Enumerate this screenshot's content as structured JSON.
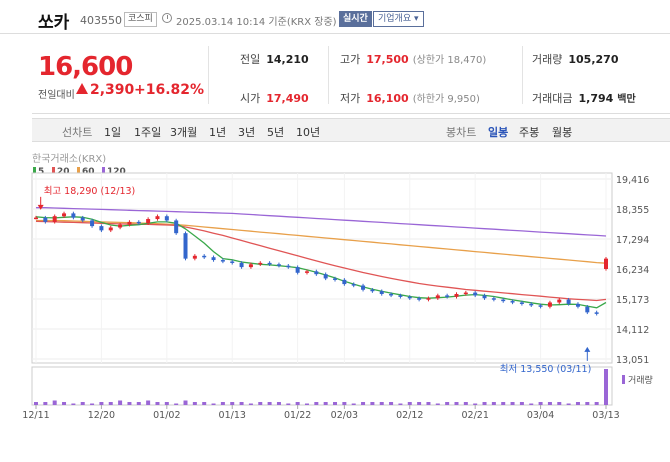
{
  "header": {
    "name": "쏘카",
    "code": "403550",
    "market": "코스피",
    "asof": "2025.03.14 10:14 기준(KRX 장중)",
    "realtime": "실시간",
    "company": "기업개요 ▾"
  },
  "quote": {
    "price": "16,600",
    "prev_label": "전일대비",
    "change": "2,390",
    "change_pct": "+16.82%",
    "prev_close": {
      "label": "전일",
      "value": "14,210"
    },
    "open": {
      "label": "시가",
      "value": "17,490"
    },
    "high": {
      "label": "고가",
      "value": "17,500",
      "sub": "(상한가 18,470)"
    },
    "low": {
      "label": "저가",
      "value": "16,100",
      "sub": "(하한가 9,950)"
    },
    "volume": {
      "label": "거래량",
      "value": "105,270"
    },
    "amount": {
      "label": "거래대금",
      "value": "1,794",
      "unit": "백만"
    }
  },
  "period": {
    "label": "선차트",
    "items": [
      "1일",
      "1주일",
      "3개월",
      "1년",
      "3년",
      "5년",
      "10년"
    ]
  },
  "candle_tabs": {
    "label": "봉차트",
    "items": [
      "일봉",
      "주봉",
      "월봉"
    ],
    "selected": 0
  },
  "chart_data": {
    "type": "line",
    "source_label": "한국거래소(KRX)",
    "ma_legend": [
      {
        "name": "5",
        "color": "#3aa84a"
      },
      {
        "name": "20",
        "color": "#e05555"
      },
      {
        "name": "60",
        "color": "#e8a04a"
      },
      {
        "name": "120",
        "color": "#9a66d6"
      }
    ],
    "y_ticks": [
      19416,
      18355,
      17294,
      16234,
      15173,
      14112,
      13051
    ],
    "y_tick_labels": [
      "19,416",
      "18,355",
      "17,294",
      "16,234",
      "15,173",
      "14,112",
      "13,051"
    ],
    "ylim": [
      13051,
      19416
    ],
    "x_ticks": [
      "12/11",
      "12/20",
      "01/02",
      "01/13",
      "01/22",
      "02/03",
      "02/12",
      "02/21",
      "03/04",
      "03/13"
    ],
    "x_tick_index": [
      0,
      7,
      14,
      21,
      28,
      33,
      40,
      47,
      54,
      61
    ],
    "n_days": 62,
    "close": [
      18050,
      17900,
      18100,
      18200,
      18050,
      17950,
      17750,
      17600,
      17700,
      17800,
      17900,
      17850,
      18000,
      18100,
      17950,
      17500,
      16600,
      16700,
      16650,
      16550,
      16500,
      16450,
      16300,
      16400,
      16450,
      16400,
      16350,
      16300,
      16100,
      16150,
      16050,
      15900,
      15850,
      15700,
      15650,
      15500,
      15450,
      15350,
      15300,
      15250,
      15200,
      15150,
      15200,
      15300,
      15250,
      15350,
      15400,
      15300,
      15200,
      15150,
      15100,
      15050,
      15000,
      14950,
      14900,
      15050,
      15150,
      15000,
      14900,
      14700,
      14650,
      16600
    ],
    "ma5": [
      18080,
      18050,
      18040,
      18060,
      18080,
      18060,
      17990,
      17880,
      17790,
      17750,
      17780,
      17800,
      17850,
      17900,
      17900,
      17850,
      17650,
      17400,
      17150,
      16850,
      16600,
      16560,
      16480,
      16440,
      16400,
      16380,
      16350,
      16320,
      16280,
      16200,
      16120,
      16020,
      15920,
      15800,
      15700,
      15600,
      15520,
      15450,
      15380,
      15320,
      15260,
      15220,
      15200,
      15220,
      15240,
      15270,
      15310,
      15330,
      15300,
      15260,
      15200,
      15140,
      15090,
      15040,
      14990,
      14960,
      14970,
      14990,
      14980,
      14920,
      14860,
      15050
    ],
    "ma20": [
      17920,
      17910,
      17900,
      17890,
      17880,
      17870,
      17860,
      17850,
      17840,
      17830,
      17820,
      17810,
      17810,
      17800,
      17790,
      17780,
      17720,
      17650,
      17580,
      17500,
      17420,
      17330,
      17240,
      17150,
      17060,
      16970,
      16880,
      16790,
      16700,
      16610,
      16520,
      16430,
      16350,
      16270,
      16190,
      16110,
      16040,
      15970,
      15900,
      15840,
      15780,
      15720,
      15670,
      15630,
      15590,
      15550,
      15510,
      15480,
      15450,
      15420,
      15390,
      15360,
      15330,
      15300,
      15270,
      15240,
      15210,
      15180,
      15160,
      15140,
      15120,
      15160
    ],
    "ma60": [
      17950,
      17950,
      17950,
      17940,
      17930,
      17920,
      17910,
      17900,
      17890,
      17880,
      17870,
      17860,
      17850,
      17840,
      17820,
      17800,
      17780,
      17750,
      17720,
      17690,
      17660,
      17630,
      17600,
      17570,
      17540,
      17510,
      17480,
      17450,
      17420,
      17390,
      17360,
      17330,
      17300,
      17270,
      17240,
      17210,
      17180,
      17150,
      17120,
      17090,
      17060,
      17030,
      17000,
      16970,
      16940,
      16910,
      16880,
      16850,
      16820,
      16790,
      16760,
      16730,
      16700,
      16670,
      16640,
      16610,
      16580,
      16550,
      16520,
      16490,
      16460,
      16440
    ],
    "ma120": [
      18400,
      18400,
      18390,
      18380,
      18370,
      18360,
      18350,
      18340,
      18330,
      18320,
      18310,
      18300,
      18290,
      18280,
      18270,
      18260,
      18250,
      18240,
      18230,
      18220,
      18210,
      18200,
      18180,
      18160,
      18140,
      18120,
      18100,
      18080,
      18060,
      18040,
      18020,
      18000,
      17980,
      17960,
      17940,
      17920,
      17900,
      17880,
      17860,
      17840,
      17820,
      17800,
      17780,
      17760,
      17740,
      17720,
      17700,
      17680,
      17660,
      17640,
      17620,
      17600,
      17580,
      17560,
      17540,
      17520,
      17500,
      17480,
      17460,
      17440,
      17420,
      17400
    ],
    "annotations": [
      {
        "text": "최고 18,290 (12/13)",
        "index": 2,
        "value": 18290
      },
      {
        "text": "최저 13,550 (03/11)",
        "index": 59,
        "value": 13550
      }
    ],
    "volume_label": "거래량",
    "volume": [
      2,
      2,
      3,
      2,
      1,
      2,
      1,
      2,
      2,
      3,
      2,
      2,
      3,
      2,
      2,
      1,
      3,
      2,
      2,
      1,
      2,
      2,
      2,
      1,
      2,
      2,
      2,
      1,
      2,
      1,
      2,
      2,
      2,
      2,
      1,
      2,
      2,
      2,
      2,
      1,
      2,
      2,
      2,
      1,
      2,
      2,
      2,
      1,
      2,
      2,
      2,
      2,
      2,
      1,
      2,
      2,
      2,
      1,
      2,
      2,
      2,
      24
    ]
  }
}
